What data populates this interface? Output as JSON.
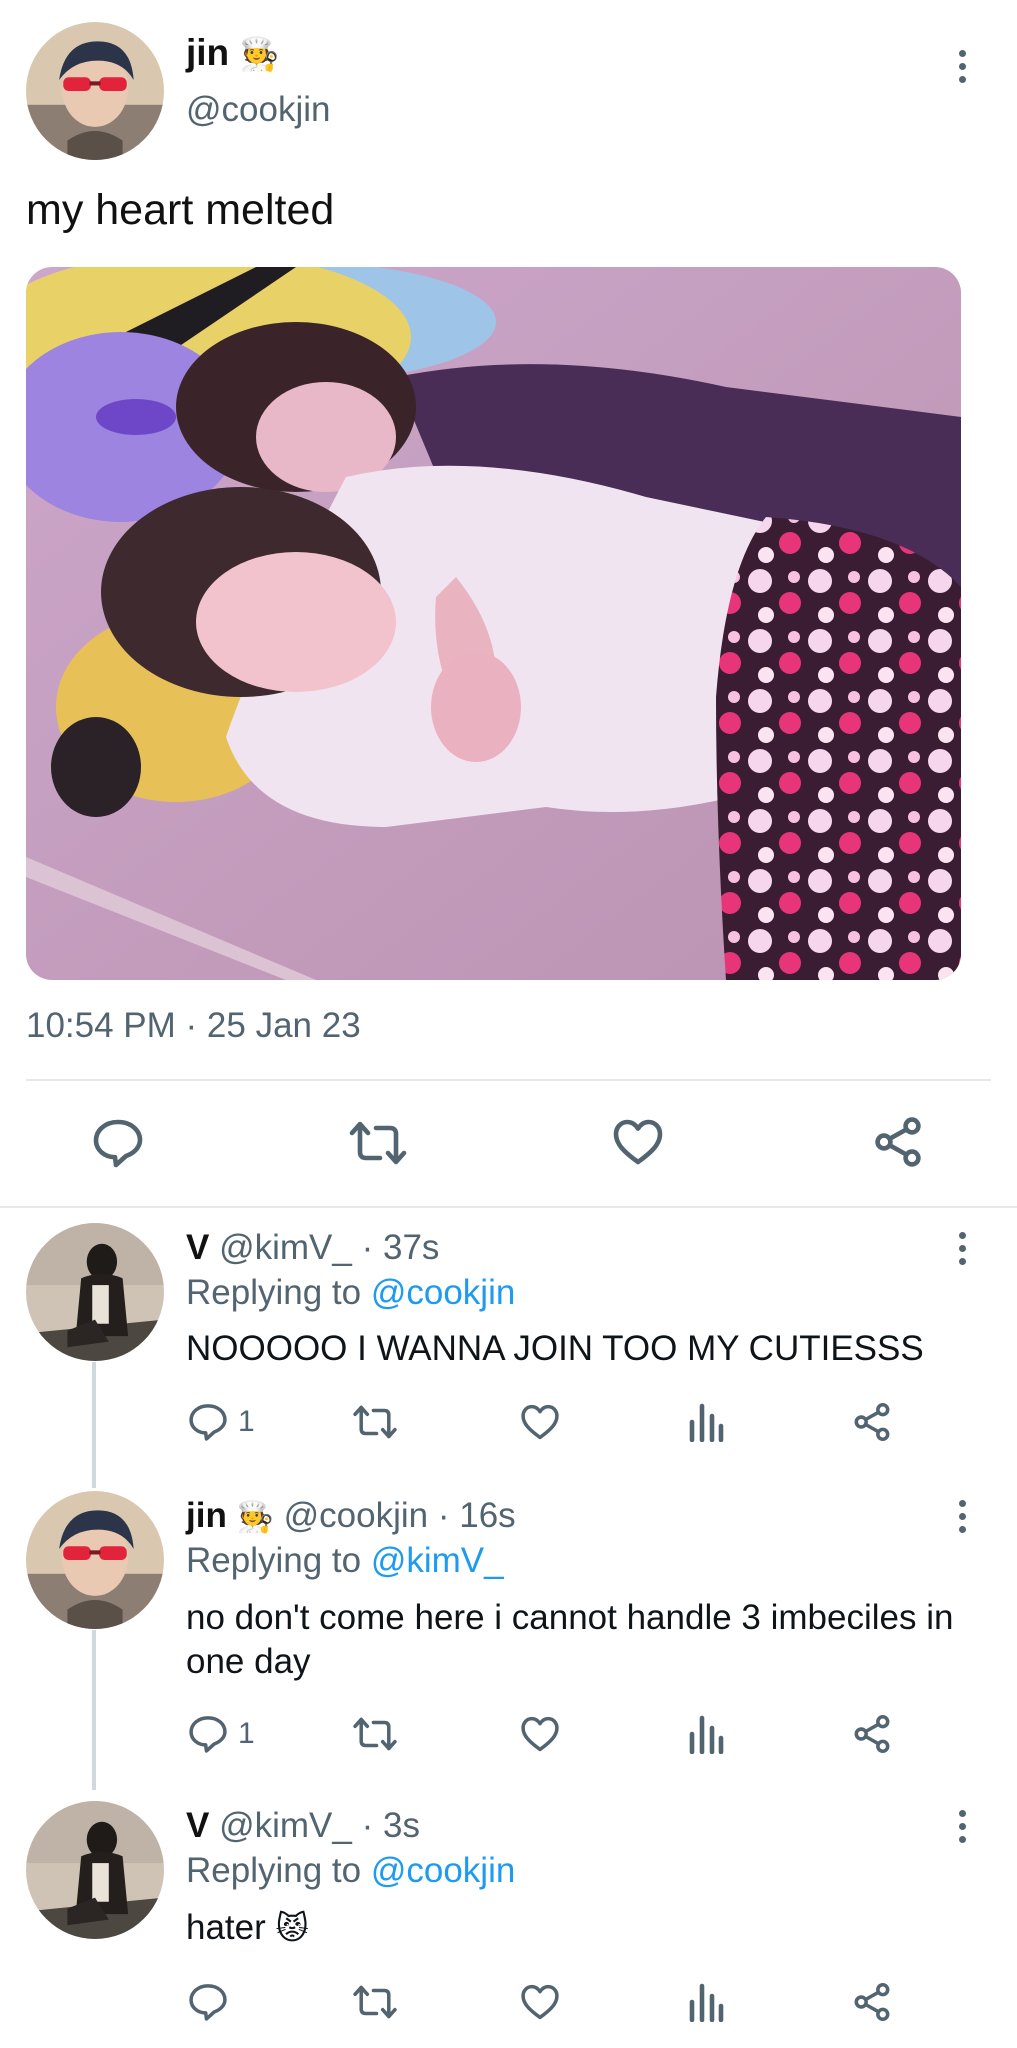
{
  "main_tweet": {
    "display_name": "jin",
    "name_emoji": "🧑‍🍳",
    "handle": "@cookjin",
    "text": "my heart melted",
    "timestamp": "10:54 PM · 25 Jan 23",
    "image_description_icon": "photo"
  },
  "replies": [
    {
      "display_name": "V",
      "handle": "@kimV_",
      "time": "· 37s",
      "replying_label": "Replying to",
      "replying_to": "@cookjin",
      "text": "NOOOOO I WANNA JOIN TOO MY CUTIESSS",
      "reply_count": "1"
    },
    {
      "display_name": "jin",
      "name_emoji": "🧑‍🍳",
      "handle": "@cookjin",
      "time": "· 16s",
      "replying_label": "Replying to",
      "replying_to": "@kimV_",
      "text": "no don't come here i cannot handle 3 imbeciles in one day",
      "reply_count": "1"
    },
    {
      "display_name": "V",
      "handle": "@kimV_",
      "time": "· 3s",
      "replying_label": "Replying to",
      "replying_to": "@cookjin",
      "text": "hater",
      "text_emoji": "😾",
      "reply_count": ""
    }
  ],
  "colors": {
    "link": "#1d9bf0",
    "muted": "#536471",
    "divider": "#e6e8ea"
  }
}
